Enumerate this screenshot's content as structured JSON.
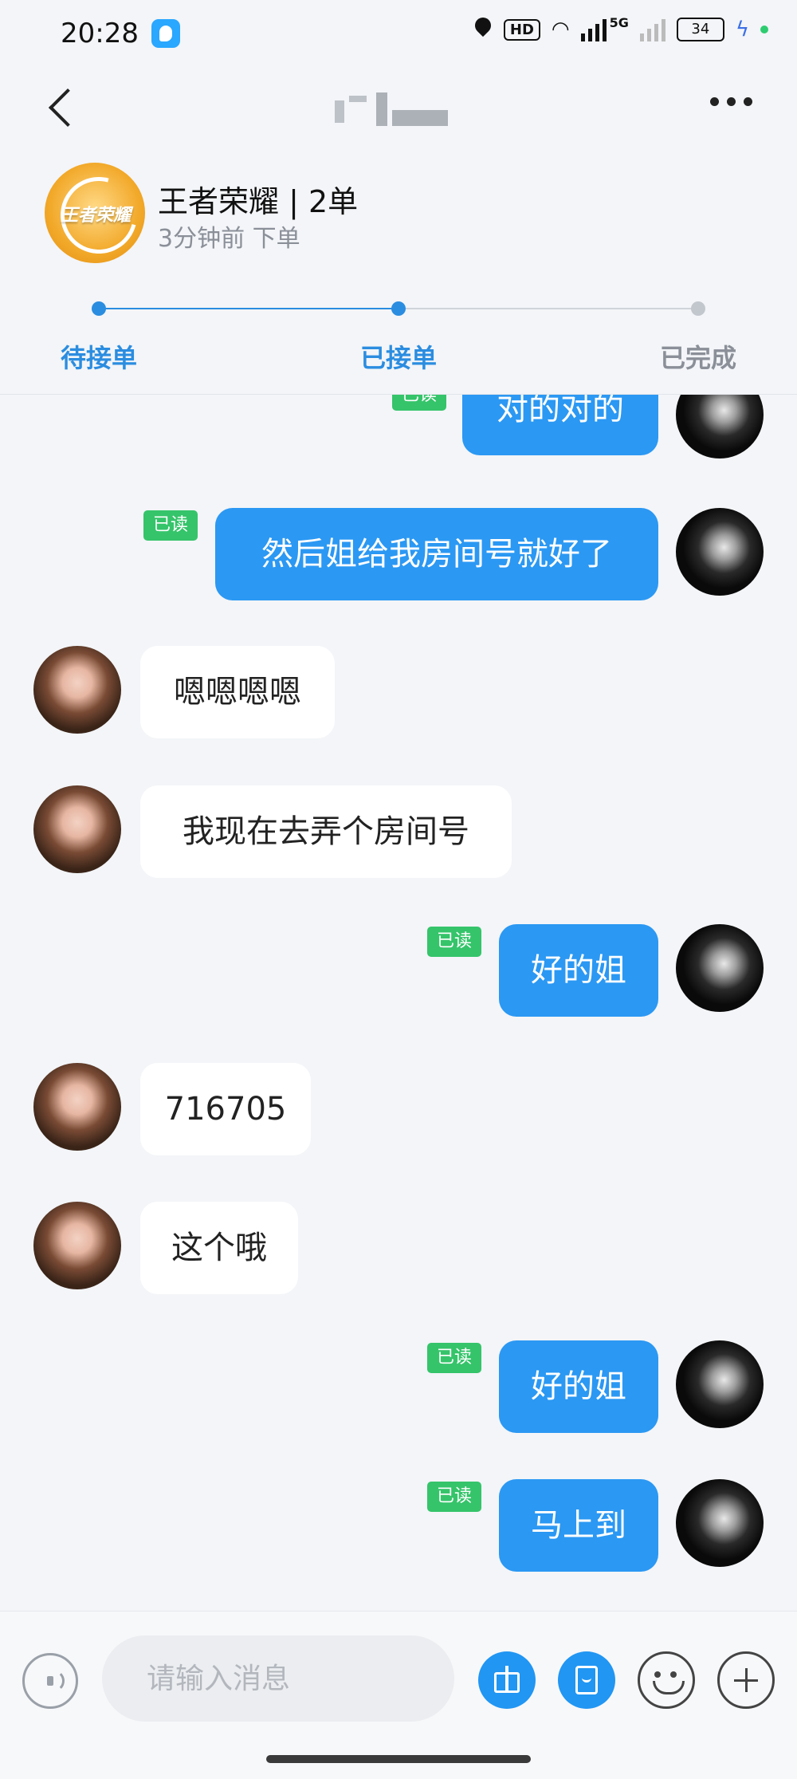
{
  "status_bar": {
    "time": "20:28",
    "network": "HD",
    "net_5g": "5G",
    "battery": "34"
  },
  "header": {
    "order": {
      "game_logo_text": "王者荣耀",
      "title": "王者荣耀 | 2单",
      "subtitle": "3分钟前 下单"
    },
    "steps": [
      {
        "label": "待接单",
        "state": "done",
        "color": "#2b8de0"
      },
      {
        "label": "已接单",
        "state": "current",
        "color": "#2b8de0"
      },
      {
        "label": "已完成",
        "state": "pending",
        "color": "#8a8f98"
      }
    ]
  },
  "messages": [
    {
      "sender": "me",
      "text": "对的对的",
      "read": "已读"
    },
    {
      "sender": "me",
      "text": "然后姐给我房间号就好了",
      "read": "已读"
    },
    {
      "sender": "her",
      "text": "嗯嗯嗯嗯"
    },
    {
      "sender": "her",
      "text": "我现在去弄个房间号"
    },
    {
      "sender": "me",
      "text": "好的姐",
      "read": "已读"
    },
    {
      "sender": "her",
      "text": "716705"
    },
    {
      "sender": "her",
      "text": "这个哦"
    },
    {
      "sender": "me",
      "text": "好的姐",
      "read": "已读"
    },
    {
      "sender": "me",
      "text": "马上到",
      "read": "已读"
    }
  ],
  "input_bar": {
    "placeholder": "请输入消息",
    "icons": [
      "voice-icon",
      "gift-icon",
      "red-packet-icon",
      "emoji-icon",
      "plus-icon"
    ]
  },
  "colors": {
    "accent": "#2b98f3",
    "read_badge": "#35c46a",
    "background": "#f3f5f8"
  }
}
